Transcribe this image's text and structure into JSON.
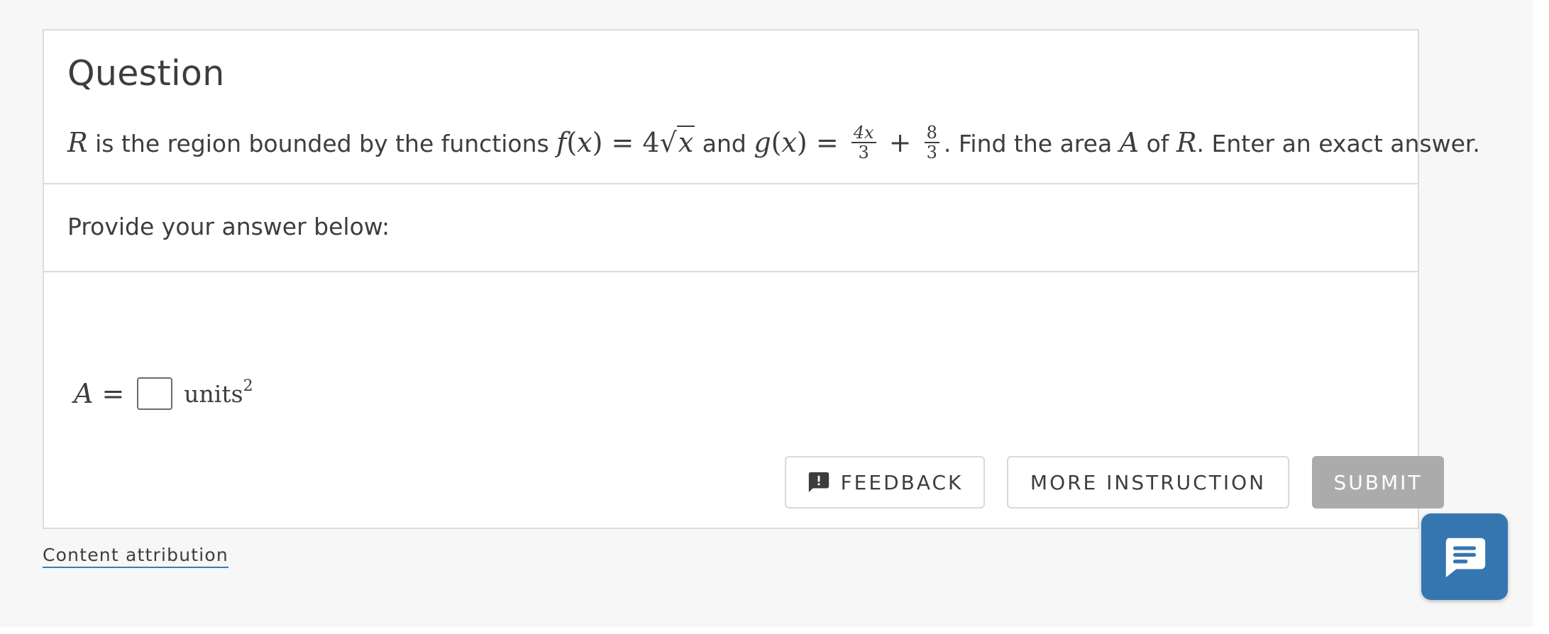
{
  "question": {
    "heading": "Question",
    "text_parts": {
      "p1_var": "R",
      "p2": " is the region bounded by the functions ",
      "f_name": "f",
      "f_arg": "(x)",
      "f_eq": " = 4",
      "f_rad": "x",
      "p3": " and ",
      "g_name": "g",
      "g_arg": "(x)",
      "g_eq": " = ",
      "frac1_num": "4x",
      "frac1_den": "3",
      "plus": " + ",
      "frac2_num": "8",
      "frac2_den": "3",
      "p4": ". Find the area ",
      "area_var": "A",
      "p5": " of ",
      "region_var": "R",
      "p6": ". Enter an exact answer."
    }
  },
  "provide": {
    "label": "Provide your answer below:"
  },
  "answer": {
    "variable": "A",
    "equals": "=",
    "input_value": "",
    "units": "units",
    "units_exp": "2"
  },
  "buttons": {
    "feedback": "FEEDBACK",
    "more_instruction": "MORE INSTRUCTION",
    "submit": "SUBMIT"
  },
  "footer": {
    "attribution": "Content attribution"
  },
  "icons": {
    "feedback": "feedback-icon",
    "chat": "chat-icon"
  },
  "colors": {
    "chat_button": "#3676b0",
    "submit_disabled": "#ababab",
    "attribution_underline": "#3d7ab5",
    "text": "#3d3d3d"
  }
}
